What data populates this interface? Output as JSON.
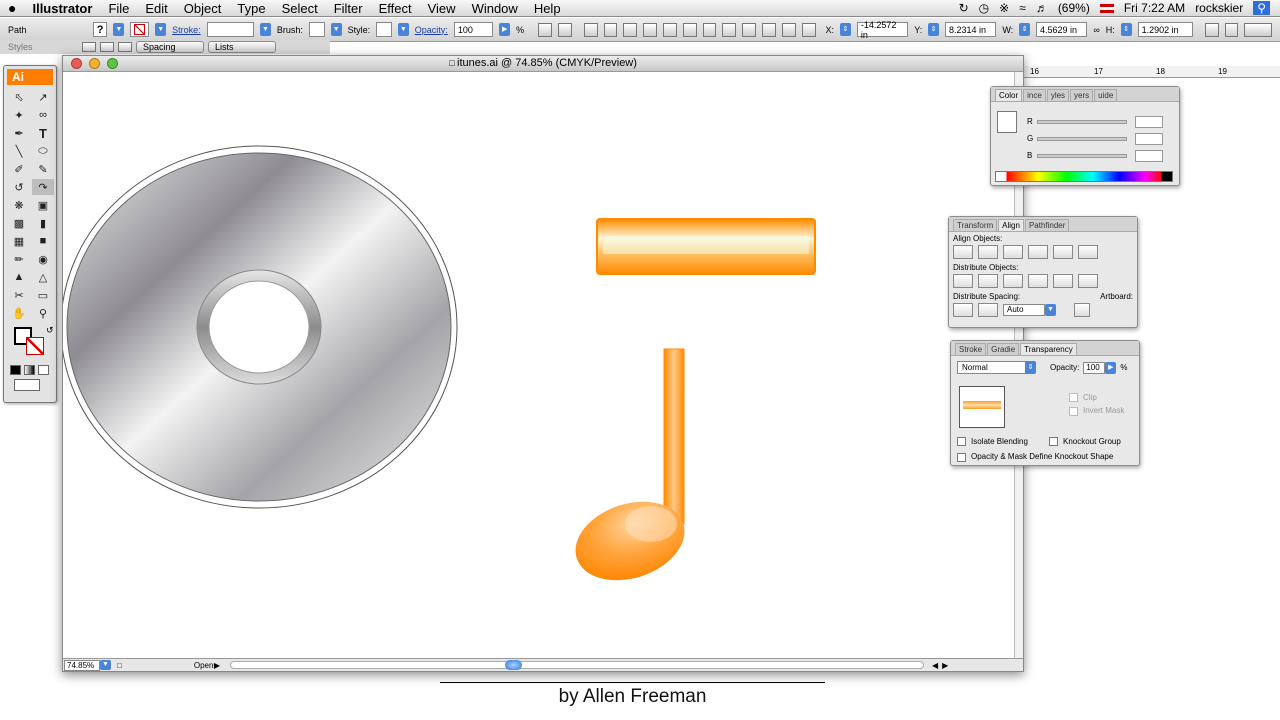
{
  "menubar": {
    "apple": "",
    "app": "Illustrator",
    "items": [
      "File",
      "Edit",
      "Object",
      "Type",
      "Select",
      "Filter",
      "Effect",
      "View",
      "Window",
      "Help"
    ],
    "battery": "(69%)",
    "clock": "Fri 7:22 AM",
    "user": "rockskier"
  },
  "control": {
    "selection": "Path",
    "stroke_label": "Stroke:",
    "brush_label": "Brush:",
    "style_label": "Style:",
    "opacity_label": "Opacity:",
    "opacity_value": "100",
    "percent": "%",
    "x_label": "X:",
    "x_value": "-14.2572 in",
    "y_label": "Y:",
    "y_value": "8.2314 in",
    "w_label": "W:",
    "w_value": "4.5629 in",
    "h_label": "H:",
    "h_value": "1.2902 in",
    "row2_label": "Styles",
    "spacing": "Spacing",
    "lists": "Lists"
  },
  "toolbox": {
    "logo": "Ai"
  },
  "document": {
    "title": "itunes.ai @ 74.85% (CMYK/Preview)",
    "zoom": "74.85%",
    "status": "Open"
  },
  "ruler": {
    "ticks": [
      "16",
      "17",
      "18",
      "19"
    ]
  },
  "color_panel": {
    "tabs": [
      "Color",
      "ince",
      "yles",
      "yers",
      "uide"
    ],
    "channels": [
      "R",
      "G",
      "B"
    ]
  },
  "align_panel": {
    "tabs": [
      "Transform",
      "Align",
      "Pathfinder"
    ],
    "align_objects": "Align Objects:",
    "distribute_objects": "Distribute Objects:",
    "distribute_spacing": "Distribute Spacing:",
    "artboard": "Artboard:",
    "spacing_value": "Auto"
  },
  "transparency_panel": {
    "tabs": [
      "Stroke",
      "Gradie",
      "Transparency"
    ],
    "blend_mode": "Normal",
    "opacity_label": "Opacity:",
    "opacity_value": "100",
    "percent": "%",
    "clip": "Clip",
    "invert_mask": "Invert Mask",
    "isolate_blending": "Isolate Blending",
    "knockout_group": "Knockout Group",
    "opacity_mask_knockout": "Opacity & Mask Define Knockout Shape"
  },
  "credit": "by Allen Freeman",
  "colors": {
    "accent_orange": "#ff8a00",
    "ai_orange": "#ff7d00",
    "blue": "#4a84d8"
  }
}
